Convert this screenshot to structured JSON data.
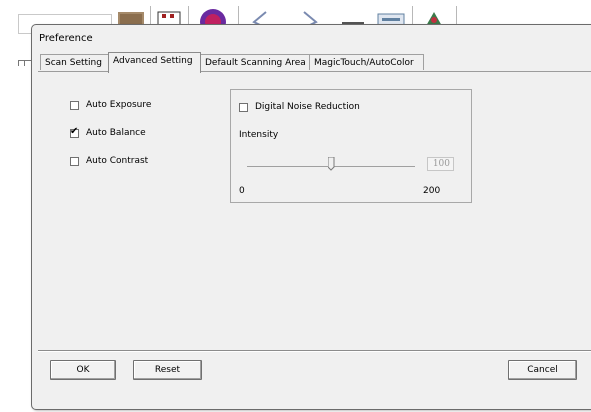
{
  "dialog": {
    "title": "Preference",
    "tabs": [
      {
        "label": "Scan Setting"
      },
      {
        "label": "Advanced Setting"
      },
      {
        "label": "Default Scanning Area"
      },
      {
        "label": "MagicTouch/AutoColor"
      }
    ],
    "active_tab": "Advanced Setting"
  },
  "checkboxes": {
    "auto_exposure": {
      "label": "Auto Exposure",
      "checked": false
    },
    "auto_balance": {
      "label": "Auto Balance",
      "checked": true
    },
    "auto_contrast": {
      "label": "Auto Contrast",
      "checked": false
    }
  },
  "noise_reduction": {
    "label": "Digital Noise Reduction",
    "checked": false,
    "intensity_label": "Intensity",
    "value": "100",
    "min_label": "0",
    "max_label": "200",
    "position_fraction": 0.5
  },
  "buttons": {
    "ok": "OK",
    "reset": "Reset",
    "cancel": "Cancel"
  },
  "icons": [
    "image-icon",
    "film-icon",
    "color-wheel-icon",
    "arrow-left-icon",
    "arrow-right-icon",
    "minus-icon",
    "scan-icon",
    "palette-icon"
  ],
  "colors": {
    "dialog_bg": "#f0f0f0",
    "border": "#6b6b6b",
    "disabled_text": "#9a9a9a"
  }
}
